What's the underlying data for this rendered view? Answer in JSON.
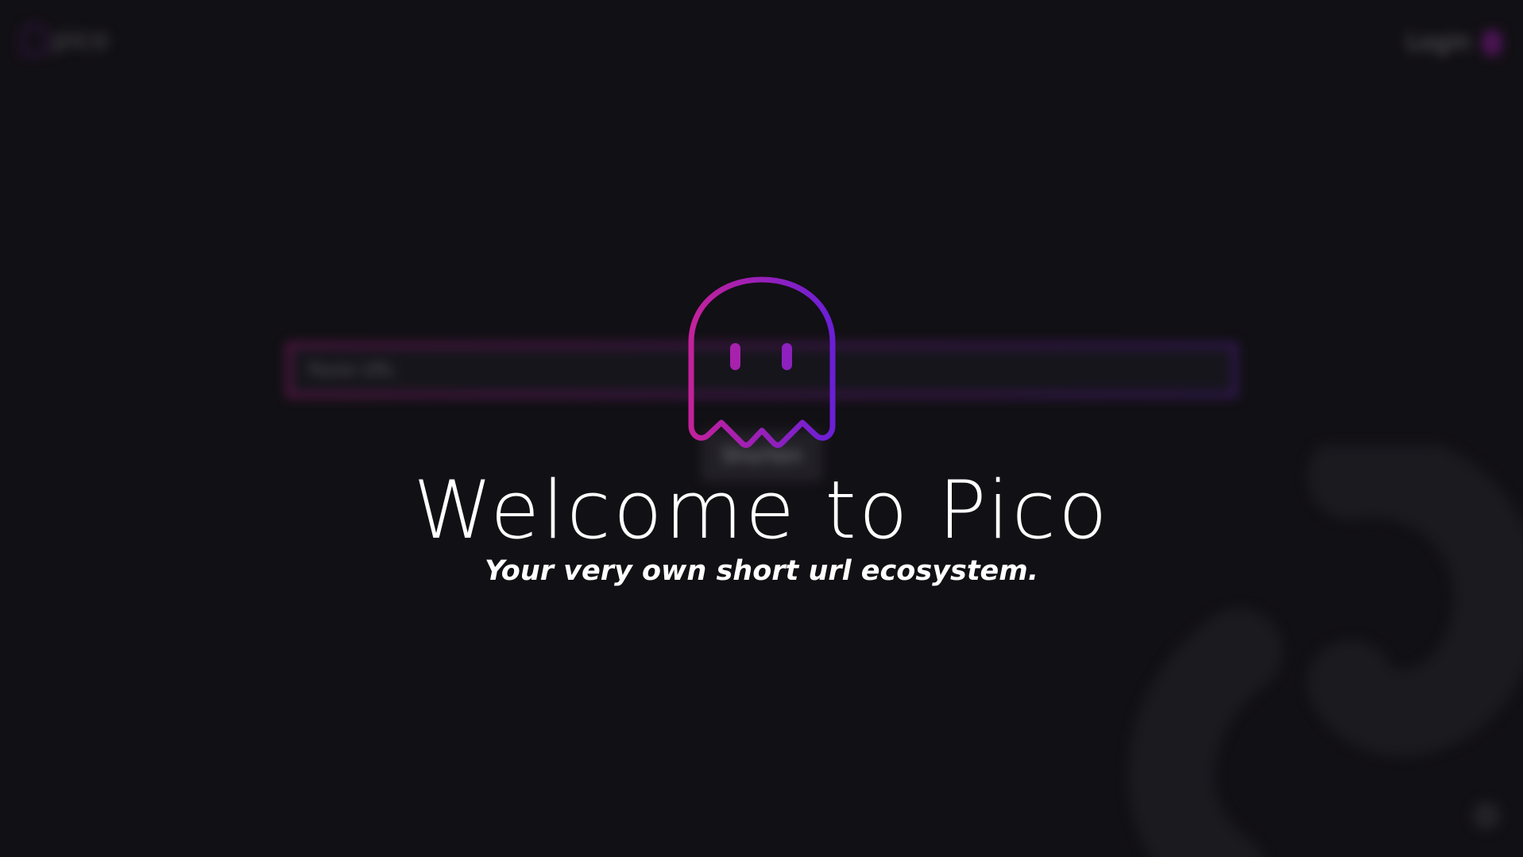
{
  "app": {
    "logo_text": "pico",
    "brand_gradient": [
      "#c4219b",
      "#6a1fd6"
    ],
    "background_color": "#121015"
  },
  "header": {
    "login_label": "Login"
  },
  "shortener": {
    "input_placeholder": "Paste URL",
    "button_label": "Shorten"
  },
  "welcome": {
    "title": "Welcome to Pico",
    "subtitle": "Your very own short url ecosystem.",
    "icon": "ghost-icon"
  },
  "decor": {
    "background_icon": "link-icon",
    "help_icon": "help-icon"
  }
}
